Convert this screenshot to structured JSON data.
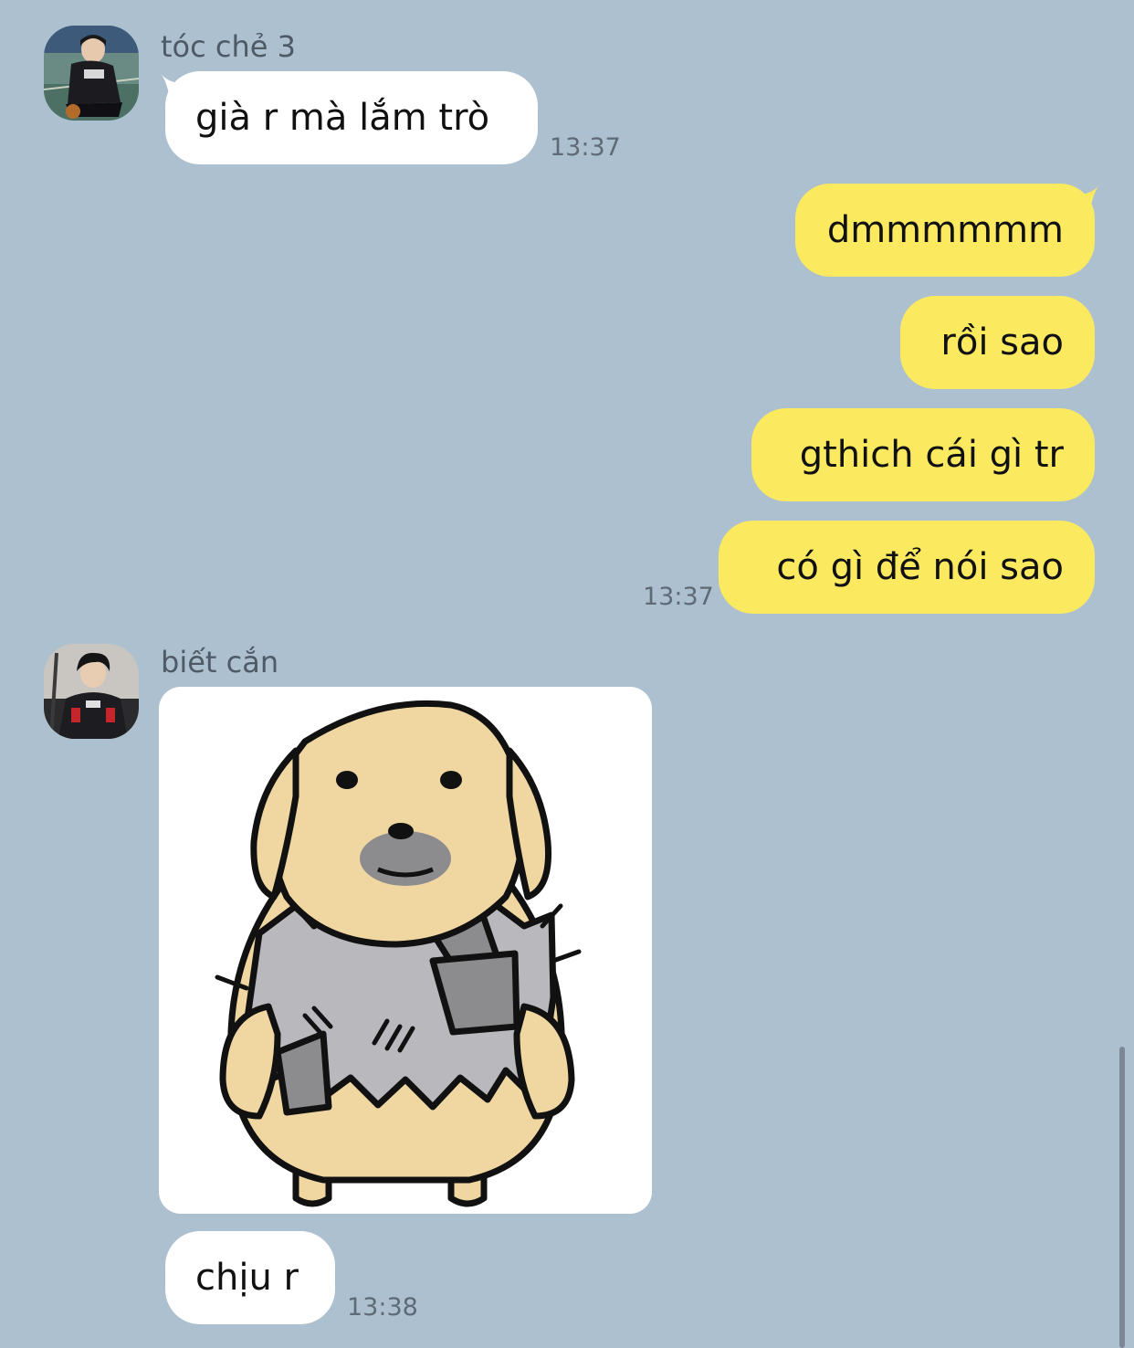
{
  "colors": {
    "background": "#acc0d0",
    "incoming_bubble": "#ffffff",
    "outgoing_bubble": "#fbe960",
    "sender_name": "#4e5a66",
    "timestamp": "#5e6a76"
  },
  "messages": [
    {
      "direction": "incoming",
      "sender": "tóc chẻ 3",
      "avatar": "user-photo-avatar",
      "items": [
        {
          "type": "text",
          "text": "già r mà lắm trò"
        }
      ],
      "time": "13:37"
    },
    {
      "direction": "outgoing",
      "items": [
        {
          "type": "text",
          "text": "dmmmmmm"
        },
        {
          "type": "text",
          "text": "rồi sao"
        },
        {
          "type": "text",
          "text": "gthich cái gì tr"
        },
        {
          "type": "text",
          "text": "có gì để nói sao"
        }
      ],
      "time": "13:37"
    },
    {
      "direction": "incoming",
      "sender": "biết cắn",
      "avatar": "user-photo-avatar",
      "items": [
        {
          "type": "sticker",
          "sticker": "ragged-dog-sticker"
        },
        {
          "type": "text",
          "text": "chịu r"
        }
      ],
      "time": "13:38"
    }
  ]
}
